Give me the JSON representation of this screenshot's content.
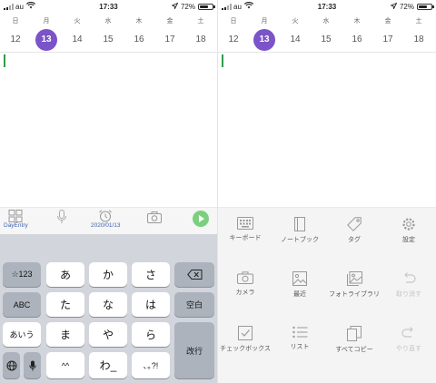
{
  "status": {
    "carrier": "au",
    "time": "17:33",
    "battery": "72%",
    "battery_level": 0.72
  },
  "week": {
    "days": [
      "日",
      "月",
      "火",
      "水",
      "木",
      "金",
      "土"
    ],
    "dates": [
      "12",
      "13",
      "14",
      "15",
      "16",
      "17",
      "18"
    ],
    "selected": "13"
  },
  "toolbar": {
    "dayentry_label": "DayEntry",
    "date_label": "2020/01/13"
  },
  "keyboard": {
    "row1": [
      "☆123",
      "あ",
      "か",
      "さ"
    ],
    "row2": [
      "ABC",
      "た",
      "な",
      "は",
      "空白"
    ],
    "row3": [
      "あいう",
      "ま",
      "や",
      "ら"
    ],
    "row4": [
      "^^",
      "わ_",
      "､｡?!"
    ],
    "enter": "改行"
  },
  "menu": {
    "items": [
      {
        "label": "キーボード",
        "icon": "keyboard-icon"
      },
      {
        "label": "ノートブック",
        "icon": "notebook-icon"
      },
      {
        "label": "タグ",
        "icon": "tag-icon"
      },
      {
        "label": "設定",
        "icon": "gear-icon"
      },
      {
        "label": "カメラ",
        "icon": "camera-icon"
      },
      {
        "label": "最近",
        "icon": "recent-photo-icon"
      },
      {
        "label": "フォトライブラリ",
        "icon": "photo-library-icon"
      },
      {
        "label": "取り消す",
        "icon": "undo-icon"
      },
      {
        "label": "チェックボックス",
        "icon": "checkbox-icon"
      },
      {
        "label": "リスト",
        "icon": "list-icon"
      },
      {
        "label": "すべてコピー",
        "icon": "copy-icon"
      },
      {
        "label": "やり直す",
        "icon": "redo-icon"
      }
    ]
  }
}
